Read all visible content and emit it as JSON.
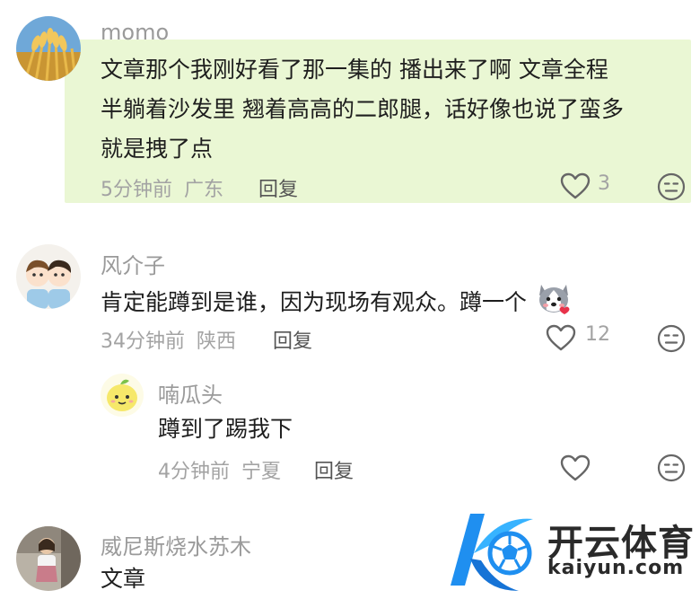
{
  "comments": [
    {
      "username": "momo",
      "lines": [
        "文章那个我刚好看了那一集的 播出来了啊 文章全程",
        "半躺着沙发里 翘着高高的二郎腿，话好像也说了蛮多",
        "就是拽了点"
      ],
      "time": "5分钟前",
      "location": "广东",
      "reply_label": "回复",
      "likes": "3",
      "highlighted": true
    },
    {
      "username": "风介子",
      "lines": [
        "肯定能蹲到是谁，因为现场有观众。蹲一个"
      ],
      "time": "34分钟前",
      "location": "陕西",
      "reply_label": "回复",
      "likes": "12",
      "replies": [
        {
          "username": "喃瓜头",
          "lines": [
            "蹲到了踢我下"
          ],
          "time": "4分钟前",
          "location": "宁夏",
          "reply_label": "回复",
          "likes": ""
        }
      ]
    },
    {
      "username": "威尼斯烧水苏木",
      "lines": [
        "文章"
      ]
    }
  ],
  "watermark": {
    "title": "开云体育",
    "subtitle": "kaiyun.com"
  },
  "icons": {
    "like": "heart-outline-icon",
    "dislike": "neutral-face-icon"
  },
  "colors": {
    "highlight": "#eaf7d4",
    "meta_text": "#a3a3a3",
    "watermark_blue": "#1f8ff0"
  }
}
